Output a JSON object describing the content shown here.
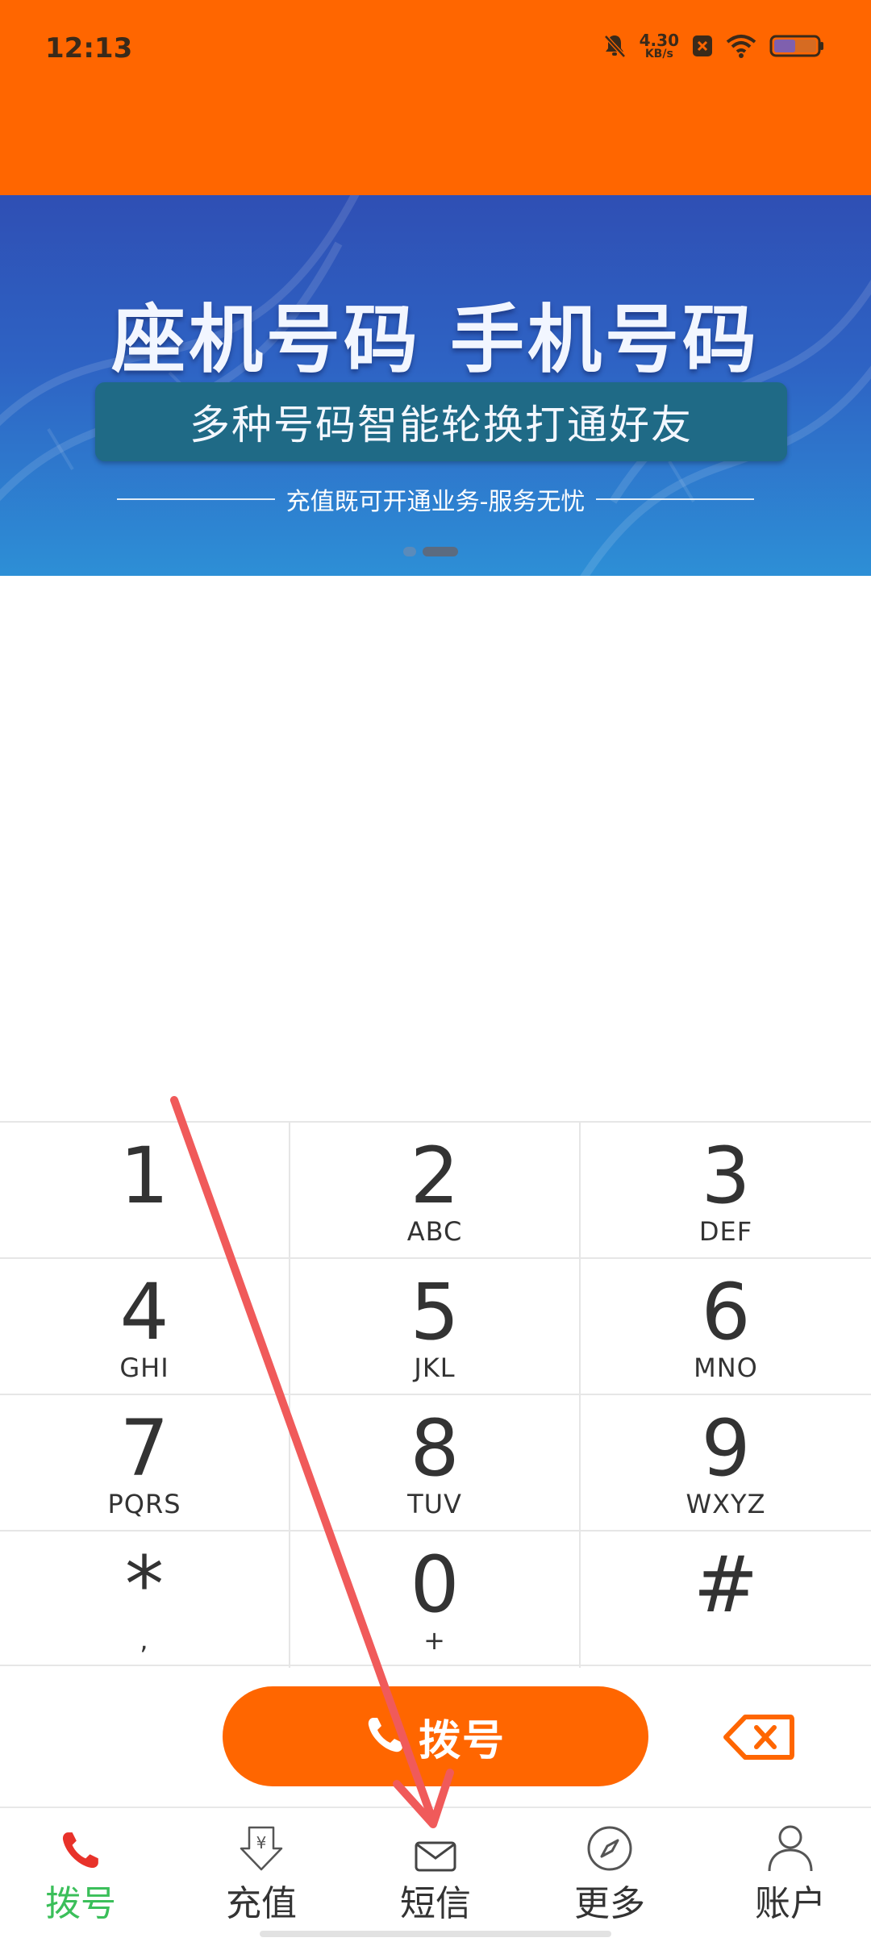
{
  "status_bar": {
    "time": "12:13",
    "net_speed_value": "4.30",
    "net_speed_unit": "KB/s",
    "battery_level": 0.5,
    "icons": [
      "bell-muted-icon",
      "sim-x-icon",
      "wifi-icon",
      "battery-icon"
    ]
  },
  "banner": {
    "title": "座机号码 手机号码",
    "strip_text": "多种号码智能轮换打通好友",
    "tagline": "充值既可开通业务-服务无忧",
    "page_count": 2,
    "active_page": 2
  },
  "keypad": {
    "keys": [
      {
        "num": "1",
        "sub": ""
      },
      {
        "num": "2",
        "sub": "ABC"
      },
      {
        "num": "3",
        "sub": "DEF"
      },
      {
        "num": "4",
        "sub": "GHI"
      },
      {
        "num": "5",
        "sub": "JKL"
      },
      {
        "num": "6",
        "sub": "MNO"
      },
      {
        "num": "7",
        "sub": "PQRS"
      },
      {
        "num": "8",
        "sub": "TUV"
      },
      {
        "num": "9",
        "sub": "WXYZ"
      },
      {
        "num": "*",
        "sub": ","
      },
      {
        "num": "0",
        "sub": "+"
      },
      {
        "num": "#",
        "sub": ""
      }
    ]
  },
  "call": {
    "label": "拨号",
    "icon": "phone-icon",
    "backspace_icon": "backspace-icon"
  },
  "bottom_nav": {
    "items": [
      {
        "label": "拨号",
        "icon": "phone-icon",
        "active": true
      },
      {
        "label": "充值",
        "icon": "yen-download-icon",
        "active": false
      },
      {
        "label": "短信",
        "icon": "mail-icon",
        "active": false
      },
      {
        "label": "更多",
        "icon": "compass-icon",
        "active": false
      },
      {
        "label": "账户",
        "icon": "user-icon",
        "active": false
      }
    ]
  },
  "colors": {
    "brand_orange": "#ff6600",
    "nav_active_green": "#3bbf5a",
    "phone_icon_red": "#e8322a",
    "annotation_arrow": "#f05a5a"
  }
}
